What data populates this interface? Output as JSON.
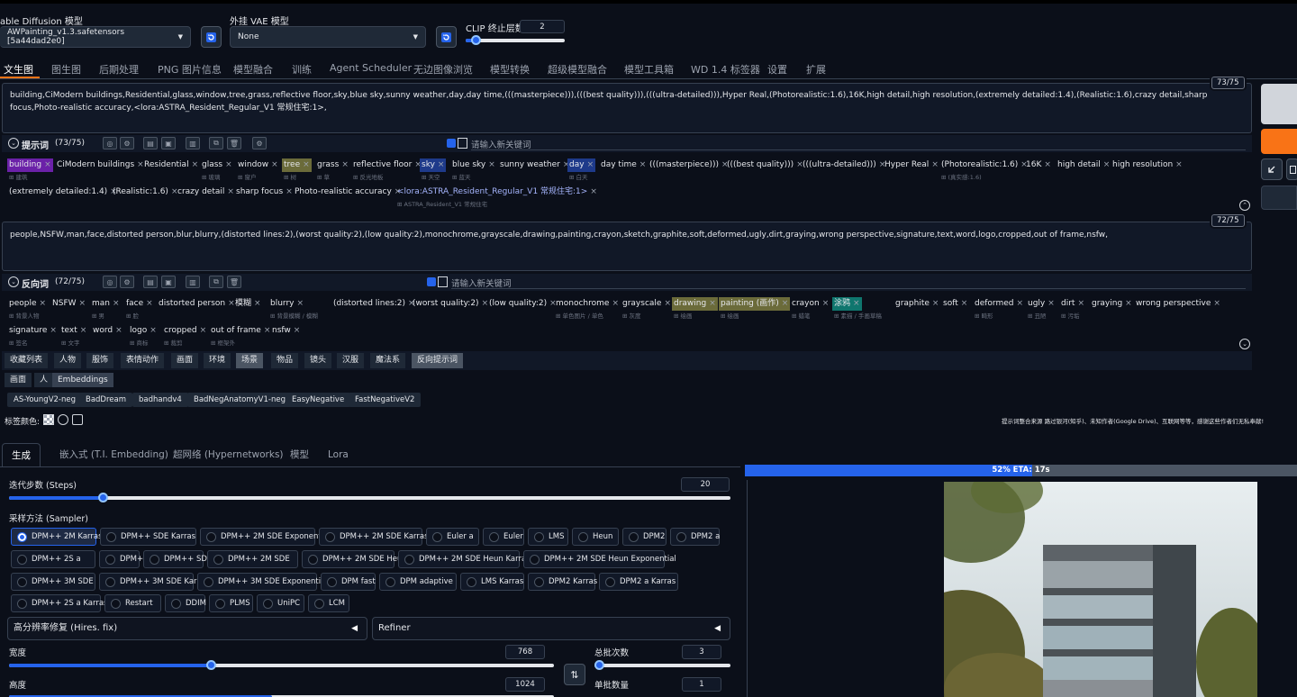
{
  "header": {
    "sd_model_label": "able Diffusion 模型",
    "sd_model_value": "AWPainting_v1.3.safetensors [5a44dad2e0]",
    "vae_label": "外挂 VAE 模型",
    "vae_value": "None",
    "clip_label": "CLIP 终止层数",
    "clip_value": "2"
  },
  "main_tabs": [
    "文生图",
    "图生图",
    "后期处理",
    "PNG 图片信息",
    "模型融合",
    "训练",
    "Agent Scheduler",
    "无边图像浏览",
    "模型转换",
    "超级模型融合",
    "模型工具箱",
    "WD 1.4 标签器",
    "设置",
    "扩展"
  ],
  "prompt": {
    "text": "building,CiModern buildings,Residential,glass,window,tree,grass,reflective floor,sky,blue sky,sunny weather,day,day time,(((masterpiece))),(((best quality))),(((ultra-detailed))),Hyper Real,(Photorealistic:1.6),16K,high detail,high resolution,(extremely detailed:1.4),(Realistic:1.6),crazy detail,sharp focus,Photo-realistic accuracy,<lora:ASTRA_Resident_Regular_V1 常规住宅:1>,",
    "counter": "73/75",
    "section_label": "提示词",
    "section_count": "(73/75)",
    "new_keyword_placeholder": "请输入新关键词",
    "tags": [
      {
        "t": "building",
        "s": "建筑",
        "c": "#6b21a8"
      },
      {
        "t": "CiModern buildings",
        "s": ""
      },
      {
        "t": "Residential",
        "s": ""
      },
      {
        "t": "glass",
        "s": "玻璃"
      },
      {
        "t": "window",
        "s": "窗户"
      },
      {
        "t": "tree",
        "s": "树",
        "c": "#6b6b3a"
      },
      {
        "t": "grass",
        "s": "草"
      },
      {
        "t": "reflective floor",
        "s": "反光地板"
      },
      {
        "t": "sky",
        "s": "天空",
        "c": "#1e3a8a"
      },
      {
        "t": "blue sky",
        "s": "蓝天"
      },
      {
        "t": "sunny weather",
        "s": ""
      },
      {
        "t": "day",
        "s": "白天",
        "c": "#1e3a8a"
      },
      {
        "t": "day time",
        "s": ""
      },
      {
        "t": "(((masterpiece)))",
        "s": ""
      },
      {
        "t": "(((best quality)))",
        "s": ""
      },
      {
        "t": "(((ultra-detailed)))",
        "s": ""
      },
      {
        "t": "Hyper Real",
        "s": ""
      },
      {
        "t": "(Photorealistic:1.6)",
        "s": "(真实感:1.6)"
      },
      {
        "t": "16K",
        "s": ""
      },
      {
        "t": "high detail",
        "s": ""
      },
      {
        "t": "high resolution",
        "s": ""
      },
      {
        "t": "(extremely detailed:1.4)",
        "s": ""
      },
      {
        "t": "(Realistic:1.6)",
        "s": ""
      },
      {
        "t": "crazy detail",
        "s": ""
      },
      {
        "t": "sharp focus",
        "s": ""
      },
      {
        "t": "Photo-realistic accuracy",
        "s": ""
      },
      {
        "t": "<lora:ASTRA_Resident_Regular_V1 常规住宅:1>",
        "s": "ASTRA_Resident_V1 常规住宅"
      }
    ]
  },
  "negative": {
    "text": "people,NSFW,man,face,distorted person,blur,blurry,(distorted lines:2),(worst quality:2),(low quality:2),monochrome,grayscale,drawing,painting,crayon,sketch,graphite,soft,deformed,ugly,dirt,graying,wrong perspective,signature,text,word,logo,cropped,out of frame,nsfw,",
    "counter": "72/75",
    "section_label": "反向词",
    "section_count": "(72/75)",
    "new_keyword_placeholder": "请输入新关键词",
    "tags": [
      {
        "t": "people",
        "s": "背景人物"
      },
      {
        "t": "NSFW",
        "s": ""
      },
      {
        "t": "man",
        "s": "男"
      },
      {
        "t": "face",
        "s": "脸"
      },
      {
        "t": "distorted person",
        "s": ""
      },
      {
        "t": "模糊",
        "s": ""
      },
      {
        "t": "blurry",
        "s": "背景模糊 / 模糊"
      },
      {
        "t": "(distorted lines:2)",
        "s": ""
      },
      {
        "t": "(worst quality:2)",
        "s": ""
      },
      {
        "t": "(low quality:2)",
        "s": ""
      },
      {
        "t": "monochrome",
        "s": "单色图片 / 单色"
      },
      {
        "t": "grayscale",
        "s": "灰度"
      },
      {
        "t": "drawing",
        "s": "绘画",
        "c": "#6b6b3a"
      },
      {
        "t": "painting (画作)",
        "s": "绘画",
        "c": "#6b6b3a"
      },
      {
        "t": "crayon",
        "s": "蜡笔"
      },
      {
        "t": "涂鸦",
        "s": "素描 / 手画草稿",
        "c": "#0f766e"
      },
      {
        "t": "graphite",
        "s": ""
      },
      {
        "t": "soft",
        "s": ""
      },
      {
        "t": "deformed",
        "s": "畸形"
      },
      {
        "t": "ugly",
        "s": "丑陋"
      },
      {
        "t": "dirt",
        "s": "污垢"
      },
      {
        "t": "graying",
        "s": ""
      },
      {
        "t": "wrong perspective",
        "s": ""
      },
      {
        "t": "signature",
        "s": "签名"
      },
      {
        "t": "text",
        "s": "文字"
      },
      {
        "t": "word",
        "s": ""
      },
      {
        "t": "logo",
        "s": "商标"
      },
      {
        "t": "cropped",
        "s": "裁剪"
      },
      {
        "t": "out of frame",
        "s": "框架外"
      },
      {
        "t": "nsfw",
        "s": ""
      }
    ]
  },
  "categories": [
    "收藏列表",
    "人物",
    "服饰",
    "表情动作",
    "画面",
    "环境",
    "场景",
    "物品",
    "镜头",
    "汉服",
    "魔法系",
    "反向提示词"
  ],
  "subcategories": [
    "画面",
    "人",
    "Embeddings"
  ],
  "embeddings": [
    "AS-YoungV2-neg",
    "BadDream",
    "badhandv4",
    "BadNegAnatomyV1-neg",
    "EasyNegative",
    "FastNegativeV2"
  ],
  "tag_color_label": "标签颜色:",
  "credit_note": "提示词整合来源 路过银河(知乎)、未知作者(Google Drive)、互联网等等，感谢这些作者们无私奉献!",
  "gen_tabs": [
    "生成",
    "嵌入式 (T.I. Embedding)",
    "超网络 (Hypernetworks)",
    "模型",
    "Lora"
  ],
  "steps": {
    "label": "迭代步数 (Steps)",
    "value": "20",
    "fraction": 0.13
  },
  "sampler": {
    "label": "采样方法 (Sampler)",
    "selected": "DPM++ 2M Karras",
    "rows": [
      [
        "DPM++ 2M Karras",
        "DPM++ SDE Karras",
        "DPM++ 2M SDE Exponential",
        "DPM++ 2M SDE Karras",
        "Euler a",
        "Euler",
        "LMS",
        "Heun",
        "DPM2",
        "DPM2 a"
      ],
      [
        "DPM++ 2S a",
        "DPM++ 2M",
        "DPM++ SDE",
        "DPM++ 2M SDE",
        "DPM++ 2M SDE Heun",
        "DPM++ 2M SDE Heun Karras",
        "DPM++ 2M SDE Heun Exponential"
      ],
      [
        "DPM++ 3M SDE",
        "DPM++ 3M SDE Karras",
        "DPM++ 3M SDE Exponential",
        "DPM fast",
        "DPM adaptive",
        "LMS Karras",
        "DPM2 Karras",
        "DPM2 a Karras"
      ],
      [
        "DPM++ 2S a Karras",
        "Restart",
        "DDIM",
        "PLMS",
        "UniPC",
        "LCM"
      ]
    ]
  },
  "hires_label": "高分辨率修复 (Hires. fix)",
  "refiner_label": "Refiner",
  "width": {
    "label": "宽度",
    "value": "768",
    "fraction": 0.37
  },
  "height": {
    "label": "高度",
    "value": "1024"
  },
  "batch_count": {
    "label": "总批次数",
    "value": "3",
    "fraction": 0.03
  },
  "batch_size": {
    "label": "单批数量",
    "value": "1"
  },
  "progress": {
    "text": "52% ETA: 17s",
    "fraction": 0.52
  }
}
